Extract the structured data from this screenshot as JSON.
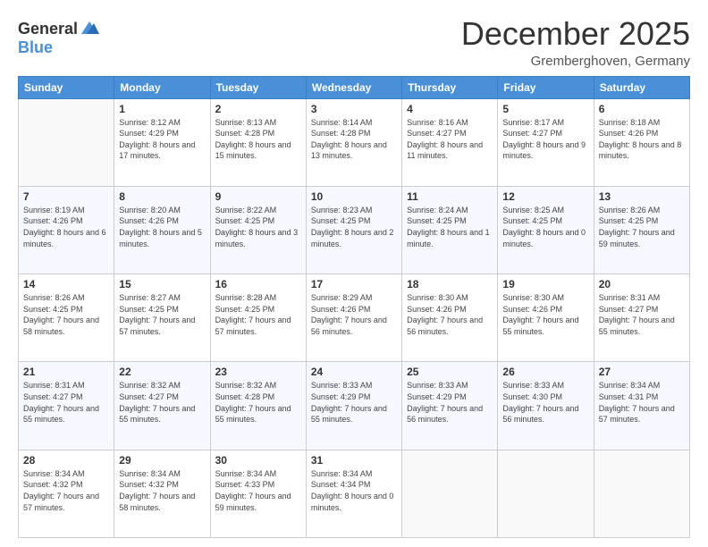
{
  "logo": {
    "general": "General",
    "blue": "Blue"
  },
  "header": {
    "month": "December 2025",
    "location": "Gremberghoven, Germany"
  },
  "days_of_week": [
    "Sunday",
    "Monday",
    "Tuesday",
    "Wednesday",
    "Thursday",
    "Friday",
    "Saturday"
  ],
  "weeks": [
    [
      {
        "day": "",
        "sunrise": "",
        "sunset": "",
        "daylight": ""
      },
      {
        "day": "1",
        "sunrise": "Sunrise: 8:12 AM",
        "sunset": "Sunset: 4:29 PM",
        "daylight": "Daylight: 8 hours and 17 minutes."
      },
      {
        "day": "2",
        "sunrise": "Sunrise: 8:13 AM",
        "sunset": "Sunset: 4:28 PM",
        "daylight": "Daylight: 8 hours and 15 minutes."
      },
      {
        "day": "3",
        "sunrise": "Sunrise: 8:14 AM",
        "sunset": "Sunset: 4:28 PM",
        "daylight": "Daylight: 8 hours and 13 minutes."
      },
      {
        "day": "4",
        "sunrise": "Sunrise: 8:16 AM",
        "sunset": "Sunset: 4:27 PM",
        "daylight": "Daylight: 8 hours and 11 minutes."
      },
      {
        "day": "5",
        "sunrise": "Sunrise: 8:17 AM",
        "sunset": "Sunset: 4:27 PM",
        "daylight": "Daylight: 8 hours and 9 minutes."
      },
      {
        "day": "6",
        "sunrise": "Sunrise: 8:18 AM",
        "sunset": "Sunset: 4:26 PM",
        "daylight": "Daylight: 8 hours and 8 minutes."
      }
    ],
    [
      {
        "day": "7",
        "sunrise": "Sunrise: 8:19 AM",
        "sunset": "Sunset: 4:26 PM",
        "daylight": "Daylight: 8 hours and 6 minutes."
      },
      {
        "day": "8",
        "sunrise": "Sunrise: 8:20 AM",
        "sunset": "Sunset: 4:26 PM",
        "daylight": "Daylight: 8 hours and 5 minutes."
      },
      {
        "day": "9",
        "sunrise": "Sunrise: 8:22 AM",
        "sunset": "Sunset: 4:25 PM",
        "daylight": "Daylight: 8 hours and 3 minutes."
      },
      {
        "day": "10",
        "sunrise": "Sunrise: 8:23 AM",
        "sunset": "Sunset: 4:25 PM",
        "daylight": "Daylight: 8 hours and 2 minutes."
      },
      {
        "day": "11",
        "sunrise": "Sunrise: 8:24 AM",
        "sunset": "Sunset: 4:25 PM",
        "daylight": "Daylight: 8 hours and 1 minute."
      },
      {
        "day": "12",
        "sunrise": "Sunrise: 8:25 AM",
        "sunset": "Sunset: 4:25 PM",
        "daylight": "Daylight: 8 hours and 0 minutes."
      },
      {
        "day": "13",
        "sunrise": "Sunrise: 8:26 AM",
        "sunset": "Sunset: 4:25 PM",
        "daylight": "Daylight: 7 hours and 59 minutes."
      }
    ],
    [
      {
        "day": "14",
        "sunrise": "Sunrise: 8:26 AM",
        "sunset": "Sunset: 4:25 PM",
        "daylight": "Daylight: 7 hours and 58 minutes."
      },
      {
        "day": "15",
        "sunrise": "Sunrise: 8:27 AM",
        "sunset": "Sunset: 4:25 PM",
        "daylight": "Daylight: 7 hours and 57 minutes."
      },
      {
        "day": "16",
        "sunrise": "Sunrise: 8:28 AM",
        "sunset": "Sunset: 4:25 PM",
        "daylight": "Daylight: 7 hours and 57 minutes."
      },
      {
        "day": "17",
        "sunrise": "Sunrise: 8:29 AM",
        "sunset": "Sunset: 4:26 PM",
        "daylight": "Daylight: 7 hours and 56 minutes."
      },
      {
        "day": "18",
        "sunrise": "Sunrise: 8:30 AM",
        "sunset": "Sunset: 4:26 PM",
        "daylight": "Daylight: 7 hours and 56 minutes."
      },
      {
        "day": "19",
        "sunrise": "Sunrise: 8:30 AM",
        "sunset": "Sunset: 4:26 PM",
        "daylight": "Daylight: 7 hours and 55 minutes."
      },
      {
        "day": "20",
        "sunrise": "Sunrise: 8:31 AM",
        "sunset": "Sunset: 4:27 PM",
        "daylight": "Daylight: 7 hours and 55 minutes."
      }
    ],
    [
      {
        "day": "21",
        "sunrise": "Sunrise: 8:31 AM",
        "sunset": "Sunset: 4:27 PM",
        "daylight": "Daylight: 7 hours and 55 minutes."
      },
      {
        "day": "22",
        "sunrise": "Sunrise: 8:32 AM",
        "sunset": "Sunset: 4:27 PM",
        "daylight": "Daylight: 7 hours and 55 minutes."
      },
      {
        "day": "23",
        "sunrise": "Sunrise: 8:32 AM",
        "sunset": "Sunset: 4:28 PM",
        "daylight": "Daylight: 7 hours and 55 minutes."
      },
      {
        "day": "24",
        "sunrise": "Sunrise: 8:33 AM",
        "sunset": "Sunset: 4:29 PM",
        "daylight": "Daylight: 7 hours and 55 minutes."
      },
      {
        "day": "25",
        "sunrise": "Sunrise: 8:33 AM",
        "sunset": "Sunset: 4:29 PM",
        "daylight": "Daylight: 7 hours and 56 minutes."
      },
      {
        "day": "26",
        "sunrise": "Sunrise: 8:33 AM",
        "sunset": "Sunset: 4:30 PM",
        "daylight": "Daylight: 7 hours and 56 minutes."
      },
      {
        "day": "27",
        "sunrise": "Sunrise: 8:34 AM",
        "sunset": "Sunset: 4:31 PM",
        "daylight": "Daylight: 7 hours and 57 minutes."
      }
    ],
    [
      {
        "day": "28",
        "sunrise": "Sunrise: 8:34 AM",
        "sunset": "Sunset: 4:32 PM",
        "daylight": "Daylight: 7 hours and 57 minutes."
      },
      {
        "day": "29",
        "sunrise": "Sunrise: 8:34 AM",
        "sunset": "Sunset: 4:32 PM",
        "daylight": "Daylight: 7 hours and 58 minutes."
      },
      {
        "day": "30",
        "sunrise": "Sunrise: 8:34 AM",
        "sunset": "Sunset: 4:33 PM",
        "daylight": "Daylight: 7 hours and 59 minutes."
      },
      {
        "day": "31",
        "sunrise": "Sunrise: 8:34 AM",
        "sunset": "Sunset: 4:34 PM",
        "daylight": "Daylight: 8 hours and 0 minutes."
      },
      {
        "day": "",
        "sunrise": "",
        "sunset": "",
        "daylight": ""
      },
      {
        "day": "",
        "sunrise": "",
        "sunset": "",
        "daylight": ""
      },
      {
        "day": "",
        "sunrise": "",
        "sunset": "",
        "daylight": ""
      }
    ]
  ]
}
